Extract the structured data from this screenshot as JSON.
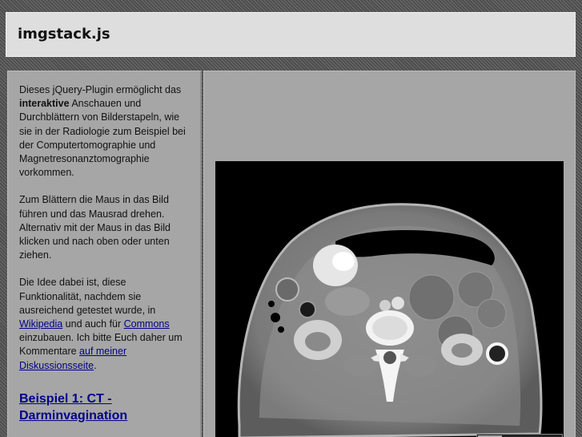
{
  "header": {
    "title": "imgstack.js"
  },
  "sidebar": {
    "intro_pre": "Dieses jQuery-Plugin ermöglicht das",
    "intro_bold": "interaktive",
    "intro_post": "Anschauen und Durchblättern von Bilderstapeln, wie sie in der Radiologie zum Beispiel bei der Computertomographie und Magnetresonanztomographie vorkommen.",
    "usage": "Zum Blättern die Maus in das Bild führen und das Mausrad drehen. Alternativ mit der Maus in das Bild klicken und nach oben oder unten ziehen.",
    "idea_pre": "Die Idee dabei ist, diese Funktionalität, nachdem sie ausreichend getestet wurde, in",
    "idea_link_wikipedia": "Wikipedia",
    "idea_mid": "und auch für",
    "idea_link_commons": "Commons",
    "idea_post": "einzubauen. Ich bitte Euch daher um Kommentare",
    "idea_link_discussion": "auf meiner Diskussionsseite",
    "idea_end": ".",
    "example_heading": "Beispiel 1: CT - Darminvagination"
  },
  "viewer": {
    "image_description_icon": "ct-abdomen-slice-image"
  }
}
